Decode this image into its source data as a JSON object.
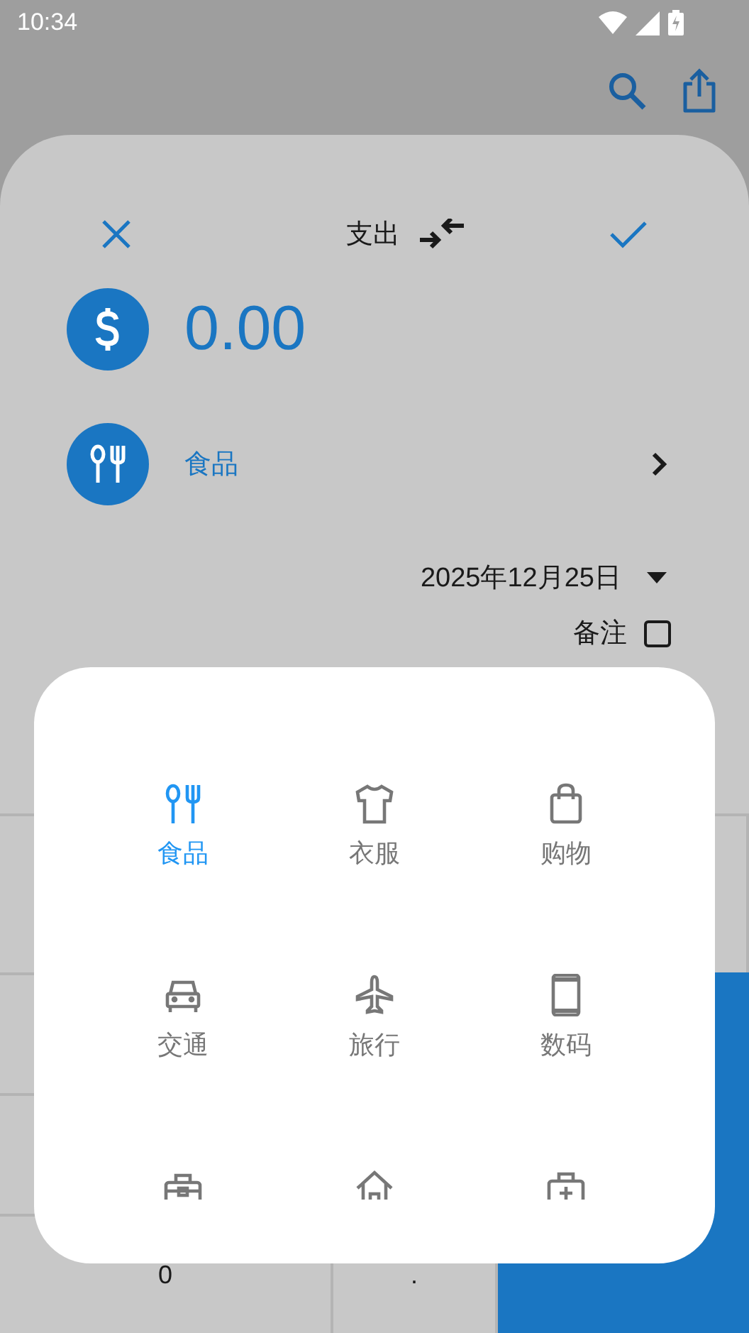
{
  "status_bar": {
    "time": "10:34"
  },
  "sheet": {
    "title": "支出",
    "amount": "0.00",
    "category": "食品",
    "date": "2025年12月25日",
    "note_label": "备注",
    "note_checked": false
  },
  "keypad": {
    "keys": [
      {
        "label": "0"
      },
      {
        "label": "."
      }
    ]
  },
  "category_dialog": {
    "items": [
      {
        "kind": "food",
        "label": "食品",
        "selected": true
      },
      {
        "kind": "clothes",
        "label": "衣服",
        "selected": false
      },
      {
        "kind": "shopping",
        "label": "购物",
        "selected": false
      },
      {
        "kind": "car",
        "label": "交通",
        "selected": false
      },
      {
        "kind": "plane",
        "label": "旅行",
        "selected": false
      },
      {
        "kind": "phone",
        "label": "数码",
        "selected": false
      },
      {
        "kind": "toolbox",
        "selected": false
      },
      {
        "kind": "house",
        "selected": false
      },
      {
        "kind": "medical",
        "selected": false
      }
    ]
  }
}
